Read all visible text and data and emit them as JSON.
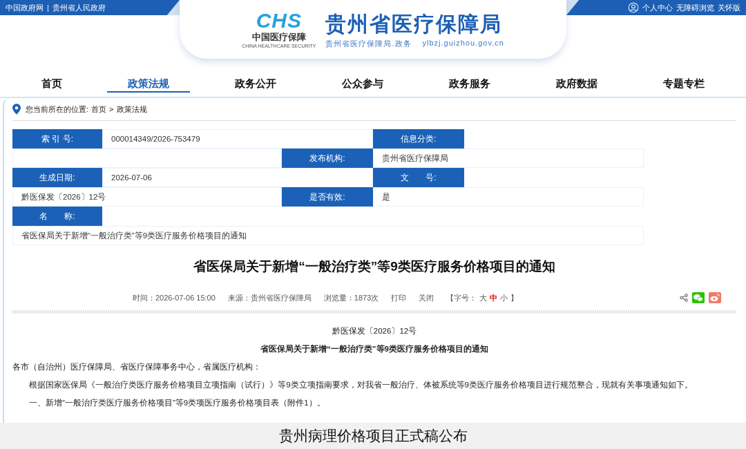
{
  "top_bar": {
    "left_links": [
      "中国政府网",
      "贵州省人民政府"
    ],
    "separator": "|",
    "right_links": [
      "个人中心",
      "无障碍浏览",
      "关怀版"
    ]
  },
  "logo": {
    "mark": "CHS",
    "name": "中国医疗保障",
    "name_en": "CHINA HEALTHCARE SECURITY",
    "site_title": "贵州省医疗保障局",
    "site_subtitle": "贵州省医疗保障局.政务",
    "url": "ylbzj.guizhou.gov.cn"
  },
  "nav": [
    {
      "label": "首页",
      "selected": false
    },
    {
      "label": "政策法规",
      "selected": true
    },
    {
      "label": "政务公开",
      "selected": false
    },
    {
      "label": "公众参与",
      "selected": false
    },
    {
      "label": "政务服务",
      "selected": false
    },
    {
      "label": "政府数据",
      "selected": false
    },
    {
      "label": "专题专栏",
      "selected": false
    }
  ],
  "breadcrumb": {
    "prefix": "您当前所在的位置:",
    "items": [
      "首页",
      "政策法规"
    ],
    "separator": ">"
  },
  "info_table": [
    {
      "cells": [
        {
          "kind": "label",
          "text": "索 引 号:"
        },
        {
          "kind": "value",
          "text": "000014349/2026-753479"
        },
        {
          "kind": "label",
          "text": "信息分类:"
        }
      ]
    },
    {
      "cells": [
        {
          "kind": "value",
          "text": ""
        },
        {
          "kind": "label",
          "text": "发布机构:"
        },
        {
          "kind": "value",
          "text": "贵州省医疗保障局"
        }
      ]
    },
    {
      "cells": [
        {
          "kind": "label",
          "text": "生成日期:"
        },
        {
          "kind": "value",
          "text": "2026-07-06"
        },
        {
          "kind": "label",
          "text": "文　　号:"
        }
      ]
    },
    {
      "cells": [
        {
          "kind": "value",
          "text": "黔医保发〔2026〕12号"
        },
        {
          "kind": "label",
          "text": "是否有效:"
        },
        {
          "kind": "value",
          "text": "是"
        }
      ]
    },
    {
      "cells": [
        {
          "kind": "label",
          "text": "名　　称:"
        }
      ]
    },
    {
      "cells": [
        {
          "kind": "value",
          "text": "省医保局关于新增“一般治疗类”等9类医疗服务价格项目的通知"
        }
      ]
    }
  ],
  "article": {
    "title": "省医保局关于新增“一般治疗类”等9类医疗服务价格项目的通知",
    "meta": [
      "时间：2026-07-06 15:00",
      "来源：贵州省医疗保障局",
      "浏览量：1873次"
    ],
    "actions": [
      "打印",
      "关闭"
    ],
    "font_size": {
      "open": "【字号：",
      "options": [
        {
          "label": "大",
          "selected": false
        },
        {
          "label": "中",
          "selected": true
        },
        {
          "label": "小",
          "selected": false
        }
      ],
      "close": "】"
    },
    "body": [
      {
        "kind": "center",
        "text": "黔医保发〔2026〕12号"
      },
      {
        "kind": "heading",
        "text": "省医保局关于新增“一般治疗类”等9类医疗服务价格项目的通知"
      },
      {
        "kind": "plain",
        "text": "各市（自治州）医疗保障局、省医疗保障事务中心，省属医疗机构："
      },
      {
        "kind": "indent",
        "text": "根据国家医保局《一般治疗类医疗服务价格项目立项指南（试行）》等9类立项指南要求，对我省一般治疗、体被系统等9类医疗服务价格项目进行规范整合，现就有关事项通知如下。"
      },
      {
        "kind": "indent",
        "text": "一、新增“一般治疗类医疗服务价格项目”等9类项医疗服务价格项目表（附件1）。"
      }
    ]
  },
  "caption": "贵州病理价格项目正式稿公布"
}
